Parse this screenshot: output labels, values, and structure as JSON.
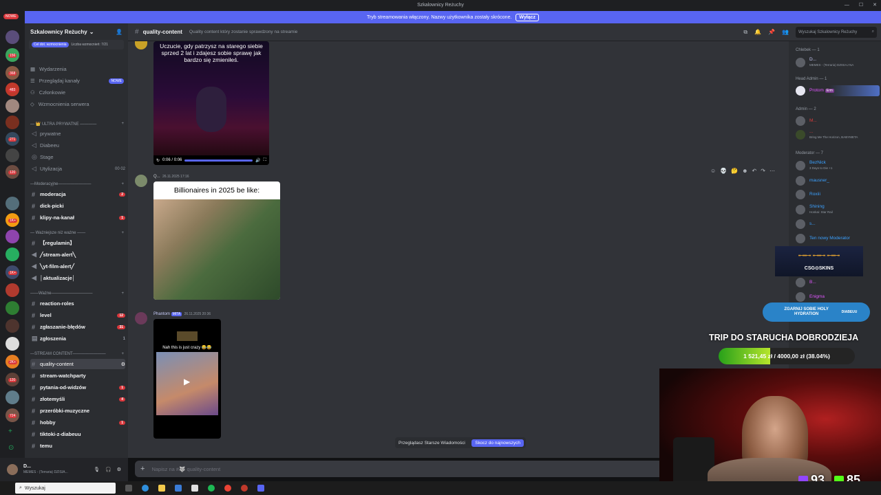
{
  "window": {
    "title": "Szkalownicy Reżuchy"
  },
  "banner": {
    "text": "Tryb streamowania włączony. Nazwy użytkownika zostały skrócone.",
    "button": "Wyłącz"
  },
  "guilds": {
    "new_badge": "NOWE",
    "badges": [
      "156",
      "368",
      "483",
      "271",
      "120",
      "1K+",
      "1K+",
      "2K+",
      "120",
      "724"
    ]
  },
  "server": {
    "name": "Szkalownicy Reżuchy",
    "boost_pill": "Cel dot. wzmocnienia",
    "boost_text": "Liczba wzmocnień: 7/21",
    "nav": [
      {
        "label": "Wydarzenia",
        "badge": ""
      },
      {
        "label": "Przeglądaj kanały",
        "badge": "NOWE"
      },
      {
        "label": "Członkowie",
        "badge": ""
      },
      {
        "label": "Wzmocnienia serwera",
        "badge": ""
      }
    ],
    "categories": {
      "ultra": "ULTRA PRYWATNE",
      "mod": "Moderacyjne",
      "important": "Ważniejsze niż ważne",
      "wazne": "Ważne",
      "stream": "STREAM CONTENT"
    },
    "channels_ultra": [
      {
        "name": "prywatne",
        "icon": "lock-icon",
        "count": ""
      },
      {
        "name": "Diabeeu",
        "icon": "speaker-icon",
        "count": ""
      },
      {
        "name": "Stage",
        "icon": "stage-icon",
        "count": ""
      },
      {
        "name": "Utylizacja",
        "icon": "speaker-icon",
        "count": "00 02"
      }
    ],
    "channels_mod": [
      {
        "name": "moderacja",
        "badge": "2"
      },
      {
        "name": "dick-picki",
        "badge": ""
      },
      {
        "name": "klipy-na-kanał",
        "badge": "1"
      }
    ],
    "channels_important": [
      {
        "name": "【regulamin】"
      },
      {
        "name": "╱stream-alert╲"
      },
      {
        "name": "╲yt-film-alert╱"
      },
      {
        "name": "│aktualizacje│"
      }
    ],
    "channels_wazne": [
      {
        "name": "reaction-roles",
        "badge": ""
      },
      {
        "name": "level",
        "badge": "12"
      },
      {
        "name": "zgłaszanie-błędów",
        "badge": "31"
      },
      {
        "name": "zgłoszenia",
        "badge": "1"
      }
    ],
    "channels_stream": [
      {
        "name": "quality-content",
        "badge": ""
      },
      {
        "name": "stream-watchparty",
        "badge": ""
      },
      {
        "name": "pytania-od-widzów",
        "badge": "1"
      },
      {
        "name": "złotemyśli",
        "badge": "4"
      },
      {
        "name": "przeróbki-muzyczne",
        "badge": ""
      },
      {
        "name": "hobby",
        "badge": "1"
      },
      {
        "name": "tiktoki-z-diabeuu",
        "badge": ""
      },
      {
        "name": "temu",
        "badge": ""
      }
    ]
  },
  "user_panel": {
    "name": "D...",
    "status": "MEMES - (Terraria) DZISIA..."
  },
  "chat": {
    "channel": "quality-content",
    "topic": "Quality content który zostanie sprawdzony na streamie",
    "search_placeholder": "Wyszukaj Szkalownicy Reżuchy",
    "msg1": {
      "caption": "Uczucie, gdy patrzysz na starego siebie sprzed 2 lat i zdajesz sobie sprawę jak bardzo się zmieniłeś.",
      "time": "0:06 / 0:06"
    },
    "msg2": {
      "author": "Q...",
      "date": "26.11.2025 17:16",
      "caption": "Billionaires in 2025 be like:"
    },
    "msg3": {
      "author": "Phantom",
      "tag": "MITA",
      "date": "26.11.2025 20:36",
      "caption": "Nah this is just crazy 😂😂"
    },
    "jump_text": "Przeglądasz Starsze Wiadomości",
    "jump_button": "Skocz do najnowszych",
    "composer_placeholder": "Napisz na #🐺 quality-content"
  },
  "members": {
    "groups": [
      {
        "title": "Chlebek — 1"
      },
      {
        "title": "Head Admin — 1"
      },
      {
        "title": "Admin — 2"
      },
      {
        "title": "Moderator — 7"
      }
    ],
    "list": [
      {
        "name": "D...",
        "sub": "MEMES - (Terraria) DZISIAJ NA",
        "color": "#c9cdfb"
      },
      {
        "name": "Protom",
        "sub": "Erm",
        "color": "#e056ff"
      },
      {
        "name": "M...",
        "sub": "",
        "color": "#e03c3c"
      },
      {
        "name": "...",
        "sub": "Bring Me The Horizon, BABYMETA",
        "color": "#e03c3c"
      },
      {
        "name": "BezNick",
        "sub": "3 Days to Die +1",
        "color": "#3ba1ff"
      },
      {
        "name": "mausner_",
        "sub": "",
        "color": "#3ba1ff"
      },
      {
        "name": "Roxiii",
        "sub": "",
        "color": "#3ba1ff"
      },
      {
        "name": "Shining",
        "sub": "Honkai: Star Rail",
        "color": "#3ba1ff"
      },
      {
        "name": "s...",
        "sub": "",
        "color": "#3ba1ff"
      },
      {
        "name": "Ten nowy Moderator",
        "sub": "",
        "color": "#3ba1ff"
      },
      {
        "name": "B...",
        "sub": "",
        "color": "#e056ff"
      },
      {
        "name": "Enigma",
        "sub": "",
        "color": "#e056ff"
      }
    ]
  },
  "overlay": {
    "goal_title": "TRIP DO STARUCHA DOBRODZIEJA",
    "goal_text": "1 521,45 zł / 4000,00 zł (38.04%)",
    "goal_fraction": 0.3804,
    "viewers": "93",
    "kick_viewers": "85",
    "csgo": "CSG⊙SKINS",
    "hydration": "ZGARNIJ SOBIE HOLY HYDRATION",
    "hydration_tag": "DIABEUU"
  },
  "taskbar": {
    "search": "Wyszukaj"
  }
}
